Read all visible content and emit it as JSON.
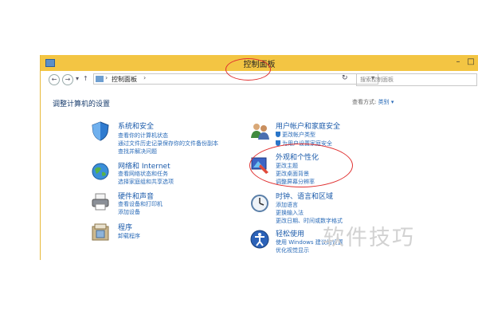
{
  "window": {
    "title": "控制面板",
    "minimize": "–",
    "maximize": "□"
  },
  "address": {
    "back": "←",
    "forward": "→",
    "up": "↑",
    "dropdown": "▾",
    "crumb": "控制面板",
    "sep": "›",
    "refresh": "↻",
    "search_placeholder": "搜索控制面板"
  },
  "page": {
    "title": "调整计算机的设置",
    "view_by_label": "查看方式:",
    "view_by_value": "类别 ▾"
  },
  "categories": [
    {
      "title": "系统和安全",
      "icon": "shield-icon",
      "links": [
        "查看你的计算机状态",
        "通过文件历史记录保存你的文件备份副本",
        "查找并解决问题"
      ]
    },
    {
      "title": "网络和 Internet",
      "icon": "globe-icon",
      "links": [
        "查看网络状态和任务",
        "选择家庭组和共享选项"
      ]
    },
    {
      "title": "硬件和声音",
      "icon": "printer-icon",
      "links": [
        "查看设备和打印机",
        "添加设备"
      ]
    },
    {
      "title": "程序",
      "icon": "programs-icon",
      "links": [
        "卸载程序"
      ]
    },
    {
      "title": "用户帐户和家庭安全",
      "icon": "users-icon",
      "links": [
        "更改帐户类型",
        "为用户设置家庭安全"
      ]
    },
    {
      "title": "外观和个性化",
      "icon": "appearance-icon",
      "links": [
        "更改主题",
        "更改桌面背景",
        "调整屏幕分辨率"
      ]
    },
    {
      "title": "时钟、语言和区域",
      "icon": "clock-icon",
      "links": [
        "添加语言",
        "更换输入法",
        "更改日期、时间或数字格式"
      ]
    },
    {
      "title": "轻松使用",
      "icon": "ease-of-access-icon",
      "links": [
        "使用 Windows 建议的设置",
        "优化视觉显示"
      ]
    }
  ],
  "watermark": "软件技巧",
  "colors": {
    "titlebar": "#f3c543",
    "link": "#2a6bb8",
    "annotation": "#e03030"
  }
}
